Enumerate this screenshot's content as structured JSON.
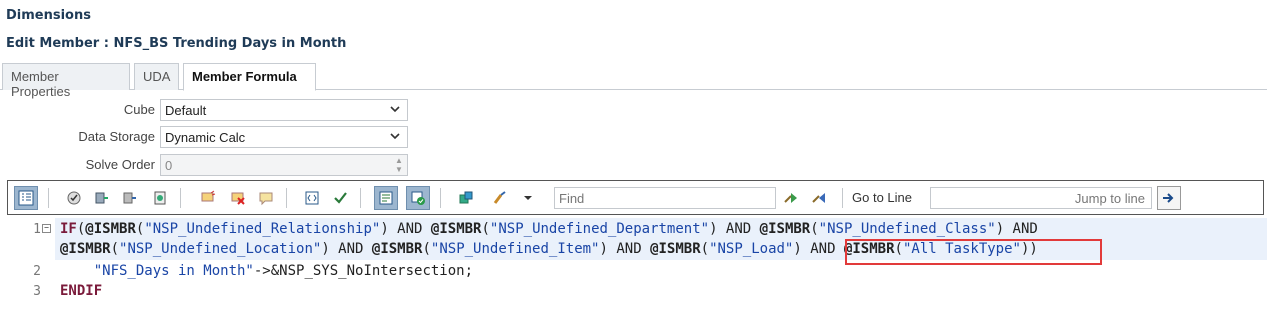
{
  "header": {
    "section_title": "Dimensions",
    "edit_title": "Edit Member : NFS_BS Trending Days in Month"
  },
  "tabs": [
    {
      "label": "Member Properties",
      "active": false
    },
    {
      "label": "UDA",
      "active": false
    },
    {
      "label": "Member Formula",
      "active": true
    }
  ],
  "form": {
    "cube": {
      "label": "Cube",
      "value": "Default"
    },
    "data_storage": {
      "label": "Data Storage",
      "value": "Dynamic Calc"
    },
    "solve_order": {
      "label": "Solve Order",
      "value": "0"
    }
  },
  "toolbar": {
    "find_placeholder": "Find",
    "goto_label": "Go to Line",
    "jump_placeholder": "Jump to line",
    "icons": [
      "line-numbers-icon",
      "validate-icon",
      "member-selector-icon",
      "function-selector-icon",
      "edit-script-icon",
      "comment-icon",
      "uncomment-icon",
      "note-icon",
      "format-icon",
      "check-syntax-icon",
      "toggle-view-icon",
      "validate-formula-icon",
      "refresh-icon",
      "brush-icon",
      "find-next-icon",
      "find-previous-icon",
      "go-icon"
    ]
  },
  "editor": {
    "line_numbers": [
      "1",
      "2",
      "3"
    ],
    "lines": [
      [
        {
          "t": "IF",
          "c": "kw"
        },
        {
          "t": "(",
          "c": ""
        },
        {
          "t": "@ISMBR",
          "c": "fn"
        },
        {
          "t": "(",
          "c": ""
        },
        {
          "t": "\"NSP_Undefined_Relationship\"",
          "c": "str"
        },
        {
          "t": ") AND ",
          "c": ""
        },
        {
          "t": "@ISMBR",
          "c": "fn"
        },
        {
          "t": "(",
          "c": ""
        },
        {
          "t": "\"NSP_Undefined_Department\"",
          "c": "str"
        },
        {
          "t": ") AND ",
          "c": ""
        },
        {
          "t": "@ISMBR",
          "c": "fn"
        },
        {
          "t": "(",
          "c": ""
        },
        {
          "t": "\"NSP_Undefined_Class\"",
          "c": "str"
        },
        {
          "t": ") AND",
          "c": ""
        }
      ],
      [
        {
          "t": "@ISMBR",
          "c": "fn"
        },
        {
          "t": "(",
          "c": ""
        },
        {
          "t": "\"NSP_Undefined_Location\"",
          "c": "str"
        },
        {
          "t": ") AND ",
          "c": ""
        },
        {
          "t": "@ISMBR",
          "c": "fn"
        },
        {
          "t": "(",
          "c": ""
        },
        {
          "t": "\"NSP_Undefined_Item\"",
          "c": "str"
        },
        {
          "t": ") AND ",
          "c": ""
        },
        {
          "t": "@ISMBR",
          "c": "fn"
        },
        {
          "t": "(",
          "c": ""
        },
        {
          "t": "\"NSP_Load\"",
          "c": "str"
        },
        {
          "t": ") AND ",
          "c": ""
        },
        {
          "t": "@ISMBR",
          "c": "fn"
        },
        {
          "t": "(",
          "c": ""
        },
        {
          "t": "\"All TaskType\"",
          "c": "str"
        },
        {
          "t": "))",
          "c": ""
        }
      ],
      [
        {
          "t": "    ",
          "c": ""
        },
        {
          "t": "\"NFS_Days in Month\"",
          "c": "str"
        },
        {
          "t": "->&NSP_SYS_NoIntersection;",
          "c": ""
        }
      ],
      [
        {
          "t": "ENDIF",
          "c": "kw"
        }
      ]
    ]
  },
  "colors": {
    "title": "#1f3b57",
    "keyword": "#7a1a3a",
    "string": "#1a45a6",
    "highlight_border": "#e23a3a",
    "active_toolbar_button": "#9cb6cf",
    "line_highlight": "#eaf1fb"
  }
}
